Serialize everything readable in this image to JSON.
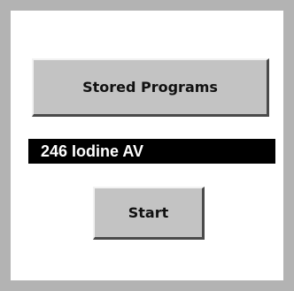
{
  "buttons": {
    "stored_programs_label": "Stored Programs",
    "start_label": "Start"
  },
  "program": {
    "selected_name": "246 Iodine AV"
  },
  "colors": {
    "frame": "#b3b3b3",
    "panel": "#ffffff",
    "button_face": "#c3c3c3",
    "program_bar": "#000000"
  }
}
